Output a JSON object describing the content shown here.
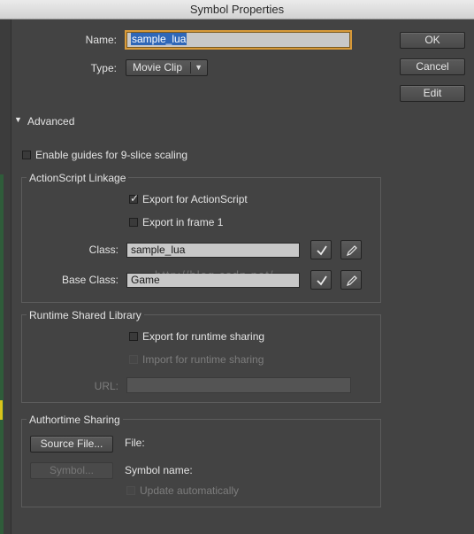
{
  "window": {
    "title": "Symbol Properties"
  },
  "name": {
    "label": "Name:",
    "value": "sample_lua"
  },
  "type": {
    "label": "Type:",
    "value": "Movie Clip"
  },
  "buttons": {
    "ok": "OK",
    "cancel": "Cancel",
    "edit": "Edit"
  },
  "advanced": {
    "label": "Advanced"
  },
  "guides": {
    "label": "Enable guides for 9-slice scaling",
    "checked": false
  },
  "actionscript": {
    "title": "ActionScript Linkage",
    "export_as": {
      "label": "Export for ActionScript",
      "checked": true
    },
    "export_frame1": {
      "label": "Export in frame 1",
      "checked": false
    },
    "class_label": "Class:",
    "class_value": "sample_lua",
    "base_class_label": "Base Class:",
    "base_class_value": "Game"
  },
  "rsl": {
    "title": "Runtime Shared Library",
    "export_runtime": {
      "label": "Export for runtime sharing",
      "checked": false
    },
    "import_runtime": {
      "label": "Import for runtime sharing",
      "checked": false
    },
    "url_label": "URL:",
    "url_value": ""
  },
  "authortime": {
    "title": "Authortime Sharing",
    "source_button": "Source File...",
    "file_label": "File:",
    "symbol_button": "Symbol...",
    "symbol_name_label": "Symbol name:",
    "update_auto": {
      "label": "Update automatically",
      "checked": false
    }
  },
  "watermark": "http://blog.csdn.net/"
}
